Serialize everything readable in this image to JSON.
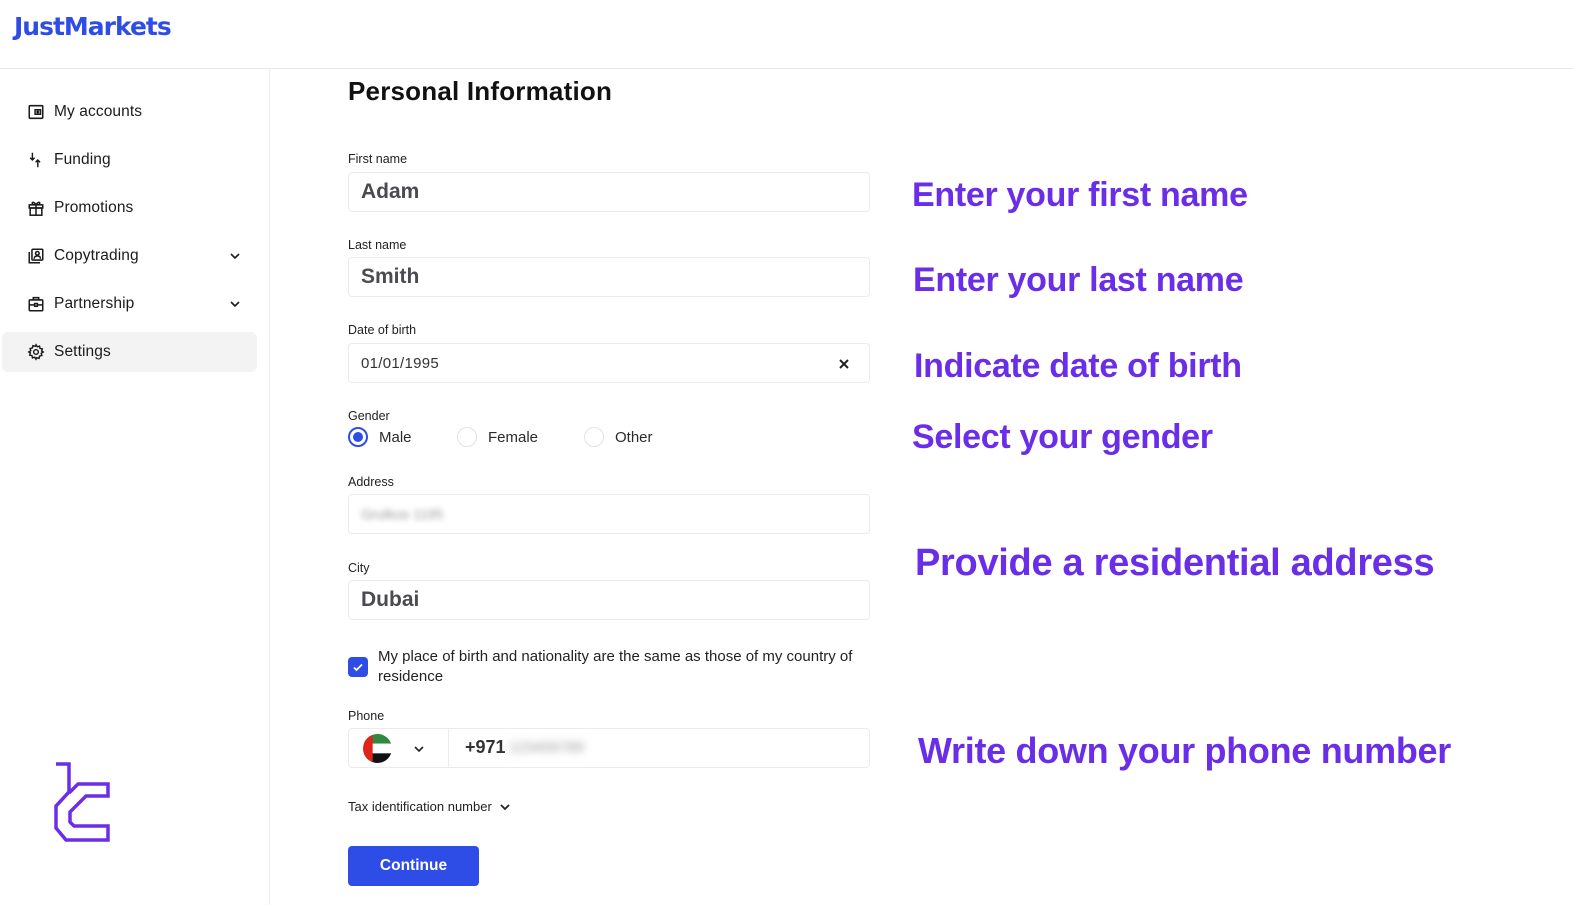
{
  "brand": {
    "name": "JustMarkets",
    "color": "#2e4de6"
  },
  "sidebar": {
    "items": [
      {
        "label": "My accounts",
        "icon": "wallet-icon",
        "expandable": false,
        "active": false
      },
      {
        "label": "Funding",
        "icon": "transfer-arrows-icon",
        "expandable": false,
        "active": false
      },
      {
        "label": "Promotions",
        "icon": "gift-icon",
        "expandable": false,
        "active": false
      },
      {
        "label": "Copytrading",
        "icon": "copytrading-icon",
        "expandable": true,
        "active": false
      },
      {
        "label": "Partnership",
        "icon": "briefcase-icon",
        "expandable": true,
        "active": false
      },
      {
        "label": "Settings",
        "icon": "gear-icon",
        "expandable": false,
        "active": true
      }
    ]
  },
  "form": {
    "title": "Personal Information",
    "first_name": {
      "label": "First name",
      "value": "Adam"
    },
    "last_name": {
      "label": "Last name",
      "value": "Smith"
    },
    "date_of_birth": {
      "label": "Date of birth",
      "value": "01/01/1995"
    },
    "gender": {
      "label": "Gender",
      "options": [
        "Male",
        "Female",
        "Other"
      ],
      "selected": "Male"
    },
    "address": {
      "label": "Address",
      "value": "Grulkos 1195"
    },
    "city": {
      "label": "City",
      "value": "Dubai"
    },
    "same_nationality": {
      "checked": true,
      "text": "My place of birth and nationality are the same as those of my country of residence"
    },
    "phone": {
      "label": "Phone",
      "country": "United Arab Emirates",
      "code": "+971",
      "number": "123456789"
    },
    "tax_id": {
      "label": "Tax identification number"
    },
    "submit_label": "Continue"
  },
  "annotations": {
    "color": "#6a2ee8",
    "first_name": "Enter your first name",
    "last_name": "Enter your last name",
    "dob": "Indicate date of birth",
    "gender": "Select your gender",
    "address": "Provide a residential address",
    "phone": "Write down your phone number"
  }
}
